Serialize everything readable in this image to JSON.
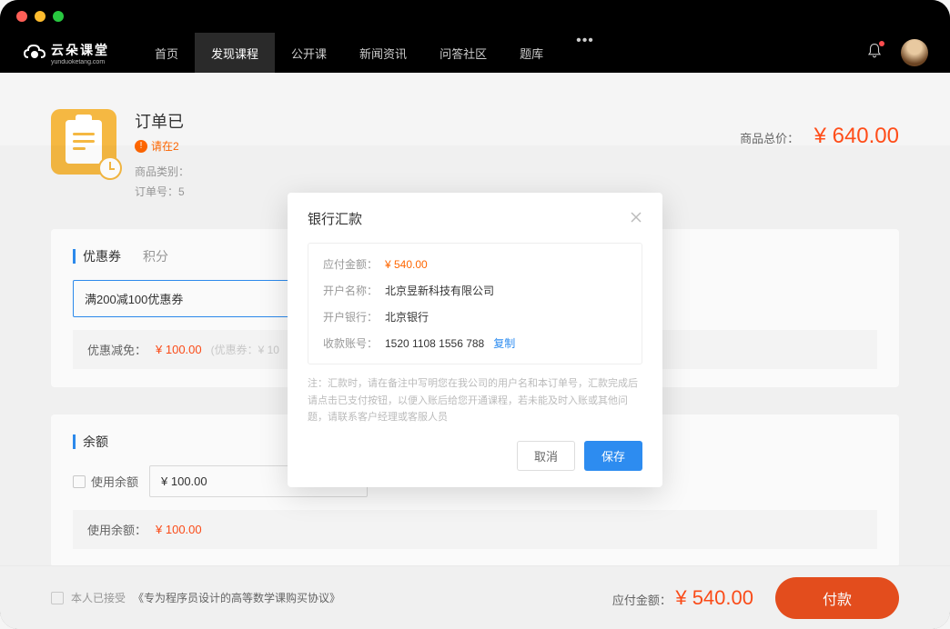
{
  "logo": {
    "cn": "云朵课堂",
    "en": "yunduoketang.com"
  },
  "nav": {
    "items": [
      "首页",
      "发现课程",
      "公开课",
      "新闻资讯",
      "问答社区",
      "题库"
    ],
    "active_index": 1
  },
  "order": {
    "title_prefix": "订单已",
    "warning_prefix": "请在2",
    "category_label": "商品类别：",
    "number_label": "订单号：5",
    "total_label": "商品总价：",
    "total_value": "¥ 640.00"
  },
  "coupon": {
    "tab_active": "优惠券",
    "tab_inactive": "积分",
    "selected": "满200减100优惠券",
    "discount_label": "优惠减免：",
    "discount_value": "¥ 100.00",
    "discount_hint_prefix": "(优惠券：¥ 10"
  },
  "balance": {
    "title": "余额",
    "use_label": "使用余额",
    "input_value": "¥ 100.00",
    "used_label": "使用余额：",
    "used_value": "¥ 100.00"
  },
  "footer": {
    "agree_prefix": "本人已接受",
    "agree_link": "《专为程序员设计的高等数学课购买协议》",
    "payable_label": "应付金额：",
    "payable_value": "¥ 540.00",
    "pay_button": "付款"
  },
  "modal": {
    "title": "银行汇款",
    "amount_label": "应付金额：",
    "amount_value": "¥ 540.00",
    "account_name_label": "开户名称：",
    "account_name_value": "北京昱新科技有限公司",
    "bank_label": "开户银行：",
    "bank_value": "北京银行",
    "account_no_label": "收款账号：",
    "account_no_value": "1520 1108 1556 788",
    "copy": "复制",
    "note": "注：汇款时，请在备注中写明您在我公司的用户名和本订单号，汇款完成后请点击已支付按钮，以便入账后给您开通课程，若未能及时入账或其他问题，请联系客户经理或客服人员",
    "cancel": "取消",
    "save": "保存"
  }
}
